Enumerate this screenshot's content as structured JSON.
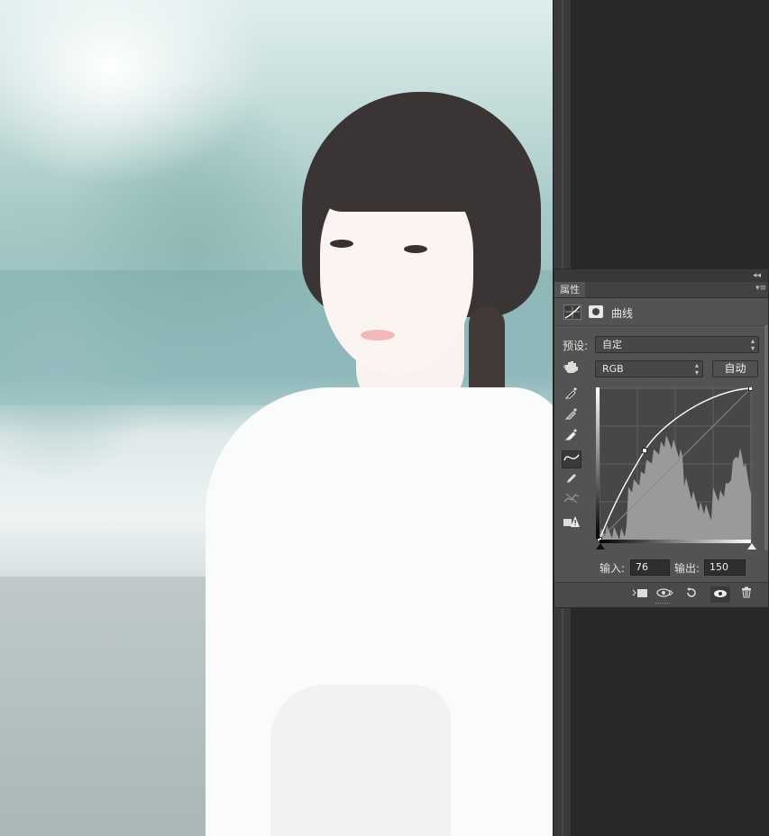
{
  "panel": {
    "collapse_glyph": "◂◂",
    "tab_label": "属性",
    "menu_glyph": "▾≡",
    "header_title": "曲线",
    "preset_label": "预设:",
    "preset_value": "自定",
    "channel_value": "RGB",
    "auto_label": "自动",
    "input_label": "输入:",
    "input_value": "76",
    "output_label": "输出:",
    "output_value": "150",
    "select_arrows": "⇕"
  },
  "curve": {
    "point_input": 76,
    "point_output": 150,
    "endpoints": [
      [
        0,
        0
      ],
      [
        255,
        255
      ]
    ]
  },
  "icons": {
    "curves_adjustment": "curves-icon",
    "layer_mask": "mask-icon",
    "target_adjust": "hand-icon",
    "eyedropper_black": "eyedropper-icon",
    "eyedropper_gray": "eyedropper-icon",
    "eyedropper_white": "eyedropper-icon",
    "edit_points": "curve-icon",
    "draw_pencil": "pencil-icon",
    "smooth": "smooth-icon",
    "clipping_warning": "warning-icon",
    "clip_to_layer": "clip-icon",
    "view_previous": "eye-icon",
    "reset": "reset-icon",
    "visibility": "eye-icon",
    "delete": "trash-icon"
  },
  "colors": {
    "panel_bg": "#535353",
    "dark_bg": "#282828",
    "curve_line": "#ffffff",
    "histogram": "#9a9a9a"
  }
}
